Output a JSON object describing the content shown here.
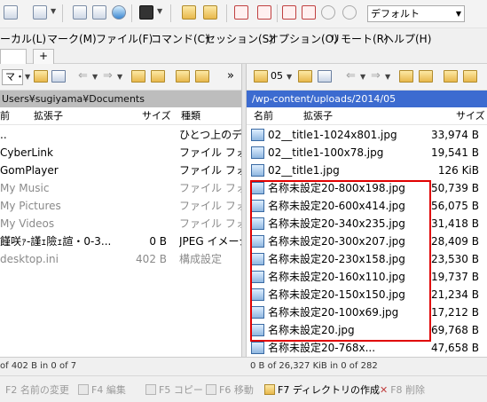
{
  "menu": {
    "items": [
      "ーカル(L)",
      "マーク(M)",
      "ファイル(F)",
      "コマンド(C)",
      "セッション(S)",
      "オプション(O)",
      "リモート(R)",
      "ヘルプ(H)"
    ]
  },
  "toolbar": {
    "charset_value": "デフォルト",
    "icons": [
      "layout-icon",
      "copy-icon",
      "new-session-icon",
      "paste-icon",
      "refresh-icon",
      "console-icon",
      "sync-icon",
      "find-icon",
      "select-icon",
      "filter-icon",
      "unselect-icon"
    ]
  },
  "tabs": {
    "plus_label": "+"
  },
  "left_pane": {
    "drive_value": "マ・",
    "path": "Users¥sugiyama¥Documents",
    "columns": [
      "前",
      "拡張子",
      "サイズ",
      "種類"
    ],
    "rows": [
      {
        "name": "..",
        "ext": "",
        "size": "",
        "type": "ひとつ上のディレ",
        "dim": false
      },
      {
        "name": "CyberLink",
        "ext": "",
        "size": "",
        "type": "ファイル フォルダ",
        "dim": false
      },
      {
        "name": "GomPlayer",
        "ext": "",
        "size": "",
        "type": "ファイル フォルダ",
        "dim": false
      },
      {
        "name": "My Music",
        "ext": "",
        "size": "",
        "type": "ファイル フォルダ",
        "dim": true
      },
      {
        "name": "My Pictures",
        "ext": "",
        "size": "",
        "type": "ファイル フォルダ",
        "dim": true
      },
      {
        "name": "My Videos",
        "ext": "",
        "size": "",
        "type": "ファイル フォルダ",
        "dim": true
      },
      {
        "name": "饉咲ｧ-謹ｪ險ｪ諠・0-3...",
        "ext": "",
        "size": "0 B",
        "type": "JPEG イメージ",
        "dim": false
      },
      {
        "name": "desktop.ini",
        "ext": "",
        "size": "402 B",
        "type": "構成設定",
        "dim": true
      }
    ],
    "status": "of 402 B in 0 of 7"
  },
  "right_pane": {
    "folder_value": "05",
    "path": "/wp-content/uploads/2014/05",
    "columns": [
      "名前",
      "拡張子",
      "サイズ"
    ],
    "rows": [
      {
        "name": "02__title1-1024x801.jpg",
        "size": "33,974 B"
      },
      {
        "name": "02__title1-100x78.jpg",
        "size": "19,541 B"
      },
      {
        "name": "02__title1.jpg",
        "size": "126 KiB"
      },
      {
        "name": "名称未設定20-800x198.jpg",
        "size": "50,739 B"
      },
      {
        "name": "名称未設定20-600x414.jpg",
        "size": "56,075 B"
      },
      {
        "name": "名称未設定20-340x235.jpg",
        "size": "31,418 B"
      },
      {
        "name": "名称未設定20-300x207.jpg",
        "size": "28,409 B"
      },
      {
        "name": "名称未設定20-230x158.jpg",
        "size": "23,530 B"
      },
      {
        "name": "名称未設定20-160x110.jpg",
        "size": "19,737 B"
      },
      {
        "name": "名称未設定20-150x150.jpg",
        "size": "21,234 B"
      },
      {
        "name": "名称未設定20-100x69.jpg",
        "size": "17,212 B"
      },
      {
        "name": "名称未設定20.jpg",
        "size": "69,768 B"
      },
      {
        "name": "名称未設定20-768x...",
        "size": "47,658 B"
      }
    ],
    "status": "0 B of 26,327 KiB in 0 of 282"
  },
  "fkeys": [
    {
      "label": "F2 名前の変更",
      "active": false,
      "icon": "rename-icon"
    },
    {
      "label": "F4 編集",
      "active": false,
      "icon": "edit-icon"
    },
    {
      "label": "F5 コピー",
      "active": false,
      "icon": "copy-icon"
    },
    {
      "label": "F6 移動",
      "active": false,
      "icon": "move-icon"
    },
    {
      "label": "F7 ディレクトリの作成",
      "active": true,
      "icon": "folder-icon"
    },
    {
      "label": "F8 削除",
      "active": false,
      "icon": "delete-icon"
    }
  ],
  "colors": {
    "highlight": "#e00000",
    "right_path_bg": "#3c6bd0",
    "left_path_bg": "#bdbdbd"
  }
}
